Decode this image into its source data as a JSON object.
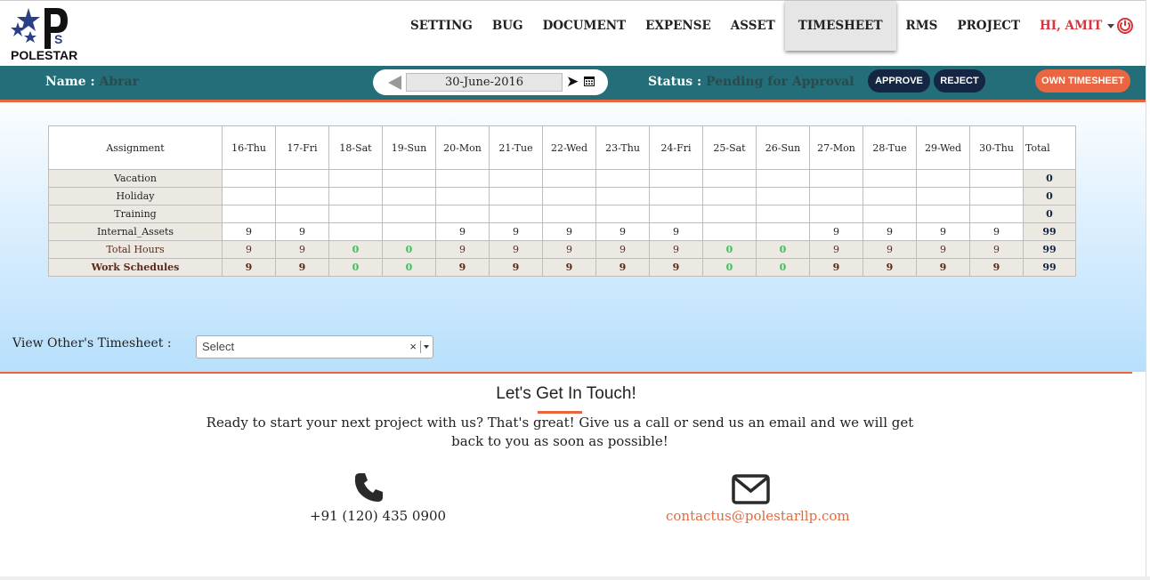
{
  "brand": {
    "name": "POLESTAR",
    "colors": {
      "teal": "#236e78",
      "orange": "#e8663d",
      "navy": "#142642",
      "weekend": "#3fbf5b"
    }
  },
  "nav": {
    "items": [
      "SETTING",
      "BUG",
      "DOCUMENT",
      "EXPENSE",
      "ASSET",
      "TIMESHEET",
      "RMS",
      "PROJECT"
    ],
    "active": "TIMESHEET",
    "user": "HI, AMIT",
    "power_icon": "power-icon"
  },
  "toolbar": {
    "name_label": "Name :",
    "name_value": "Abrar",
    "date": "30-June-2016",
    "status_label": "Status :",
    "status_value": "Pending for Approval",
    "approve": "APPROVE",
    "reject": "REJECT",
    "own": "OWN TIMESHEET"
  },
  "timesheet": {
    "header_first": "Assignment",
    "days": [
      {
        "label": "16-Thu",
        "weekend": false
      },
      {
        "label": "17-Fri",
        "weekend": false
      },
      {
        "label": "18-Sat",
        "weekend": true
      },
      {
        "label": "19-Sun",
        "weekend": true
      },
      {
        "label": "20-Mon",
        "weekend": false
      },
      {
        "label": "21-Tue",
        "weekend": false
      },
      {
        "label": "22-Wed",
        "weekend": false
      },
      {
        "label": "23-Thu",
        "weekend": false
      },
      {
        "label": "24-Fri",
        "weekend": false
      },
      {
        "label": "25-Sat",
        "weekend": true
      },
      {
        "label": "26-Sun",
        "weekend": true
      },
      {
        "label": "27-Mon",
        "weekend": false
      },
      {
        "label": "28-Tue",
        "weekend": false
      },
      {
        "label": "29-Wed",
        "weekend": false
      },
      {
        "label": "30-Thu",
        "weekend": false
      }
    ],
    "header_total": "Total",
    "rows": [
      {
        "label": "Vacation",
        "cells": [
          "",
          "",
          "",
          "",
          "",
          "",
          "",
          "",
          "",
          "",
          "",
          "",
          "",
          "",
          ""
        ],
        "total": "0",
        "kind": "input"
      },
      {
        "label": "Holiday",
        "cells": [
          "",
          "",
          "",
          "",
          "",
          "",
          "",
          "",
          "",
          "",
          "",
          "",
          "",
          "",
          ""
        ],
        "total": "0",
        "kind": "input"
      },
      {
        "label": "Training",
        "cells": [
          "",
          "",
          "",
          "",
          "",
          "",
          "",
          "",
          "",
          "",
          "",
          "",
          "",
          "",
          ""
        ],
        "total": "0",
        "kind": "input"
      },
      {
        "label": "Internal_Assets",
        "cells": [
          "9",
          "9",
          "",
          "",
          "9",
          "9",
          "9",
          "9",
          "9",
          "",
          "",
          "9",
          "9",
          "9",
          "9"
        ],
        "total": "99",
        "kind": "input"
      },
      {
        "label": "Total Hours",
        "cells": [
          "9",
          "9",
          "0",
          "0",
          "9",
          "9",
          "9",
          "9",
          "9",
          "0",
          "0",
          "9",
          "9",
          "9",
          "9"
        ],
        "total": "99",
        "kind": "summary"
      },
      {
        "label": "Work Schedules",
        "cells": [
          "9",
          "9",
          "0",
          "0",
          "9",
          "9",
          "9",
          "9",
          "9",
          "0",
          "0",
          "9",
          "9",
          "9",
          "9"
        ],
        "total": "99",
        "kind": "bold"
      }
    ]
  },
  "view_other": {
    "label": "View Other's Timesheet :",
    "placeholder": "Select",
    "clear": "×"
  },
  "contact": {
    "title": "Let's Get In Touch!",
    "text": "Ready to start your next project with us? That's great! Give us a call or send us an email and we will get back to you as soon as possible!",
    "phone": "+91 (120) 435 0900",
    "email": "contactus@polestarllp.com"
  }
}
